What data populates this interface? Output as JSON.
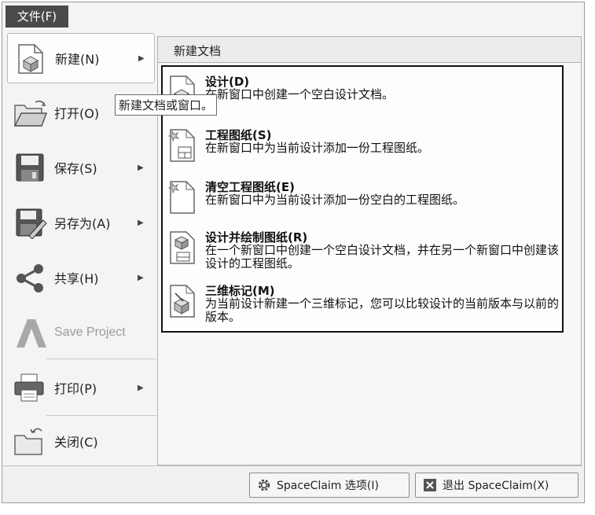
{
  "file_tab": "文件(F)",
  "menu": {
    "new": "新建(N)",
    "open": "打开(O)",
    "save": "保存(S)",
    "save_as": "另存为(A)",
    "share": "共享(H)",
    "save_project": "Save Project",
    "print": "打印(P)",
    "close": "关闭(C)"
  },
  "tooltip": "新建文档或窗口。",
  "new_panel": {
    "header": "新建文档",
    "options": [
      {
        "title": "设计(D)",
        "desc": "在新窗口中创建一个空白设计文档。",
        "icon": "new-design-icon"
      },
      {
        "title": "工程图纸(S)",
        "desc": "在新窗口中为当前设计添加一份工程图纸。",
        "icon": "drawing-sheet-icon"
      },
      {
        "title": "清空工程图纸(E)",
        "desc": "在新窗口中为当前设计添加一份空白的工程图纸。",
        "icon": "blank-sheet-icon"
      },
      {
        "title": "设计并绘制图纸(R)",
        "desc": "在一个新窗口中创建一个空白设计文档，并在另一个新窗口中创建该设计的工程图纸。",
        "icon": "design-and-drawing-icon"
      },
      {
        "title": "三维标记(M)",
        "desc": "为当前设计新建一个三维标记，您可以比较设计的当前版本与以前的版本。",
        "icon": "3d-markup-icon"
      }
    ]
  },
  "buttons": {
    "options": "SpaceClaim 选项(I)",
    "exit": "退出 SpaceClaim(X)"
  },
  "colors": {
    "file_tab_bg": "#4a4a4a",
    "options_border": "#111111"
  }
}
